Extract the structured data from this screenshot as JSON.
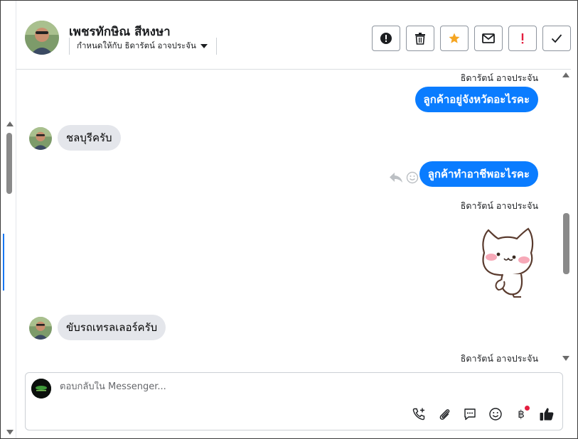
{
  "header": {
    "contact_name": "เพชรทักษิณ สีหงษา",
    "assigned_to": "กำหนดให้กับ ธิดารัตน์ อาจประจัน",
    "actions": [
      {
        "name": "report-button",
        "icon": "exclamation-circle-icon"
      },
      {
        "name": "delete-button",
        "icon": "trash-icon"
      },
      {
        "name": "star-button",
        "icon": "star-icon"
      },
      {
        "name": "mark-unread-button",
        "icon": "envelope-icon"
      },
      {
        "name": "important-button",
        "icon": "exclamation-icon"
      },
      {
        "name": "done-button",
        "icon": "check-icon"
      }
    ]
  },
  "messages": [
    {
      "type": "sender",
      "text": "ธิดารัตน์ อาจประจัน"
    },
    {
      "type": "outgoing",
      "text": "ลูกค้าอยู่จังหวัดอะไรคะ"
    },
    {
      "type": "incoming",
      "text": "ชลบุรีครับ"
    },
    {
      "type": "outgoing",
      "text": "ลูกค้าทำอาชีพอะไรคะ"
    },
    {
      "type": "sender",
      "text": "ธิดารัตน์ อาจประจัน"
    },
    {
      "type": "sticker",
      "icon": "cat-sticker-icon"
    },
    {
      "type": "incoming",
      "text": "ขับรถเทรลเลอร์ครับ"
    },
    {
      "type": "sender",
      "text": "ธิดารัตน์ อาจประจัน"
    }
  ],
  "composer": {
    "placeholder": "ตอบกลับใน Messenger...",
    "tools": [
      "call-add-icon",
      "paperclip-icon",
      "saved-reply-icon",
      "emoji-icon",
      "baht-icon",
      "thumbs-up-icon"
    ]
  },
  "colors": {
    "outgoing_bubble": "#0a7cff",
    "incoming_bubble": "#e4e6eb",
    "star": "#f5a623",
    "important": "#e41e3f"
  }
}
